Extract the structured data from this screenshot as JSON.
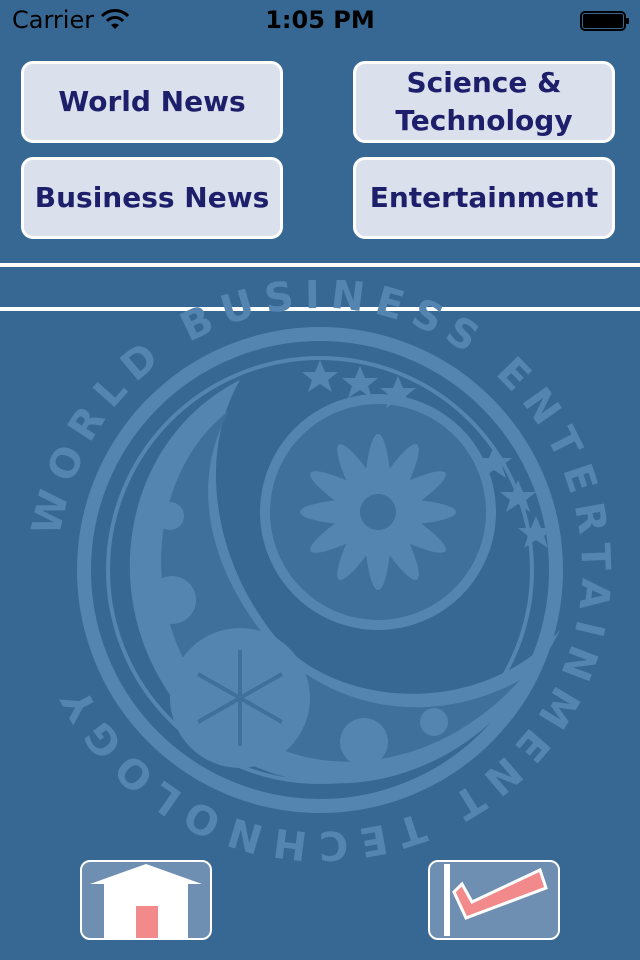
{
  "status_bar": {
    "carrier": "Carrier",
    "time": "1:05 PM"
  },
  "categories": [
    {
      "label_line1": "World News",
      "label_line2": ""
    },
    {
      "label_line1": "Science &",
      "label_line2": "Technology"
    },
    {
      "label_line1": "Business News",
      "label_line2": ""
    },
    {
      "label_line1": "Entertainment",
      "label_line2": ""
    }
  ],
  "emblem": {
    "ring_words": [
      "WORLD",
      "BUSINESS",
      "ENTERTAINMENT",
      "TECHNOLOGY"
    ]
  },
  "toolbar": {
    "home_icon": "home-icon",
    "check_icon": "checkmark-icon"
  },
  "colors": {
    "background": "#376893",
    "button_face": "#dbe1ec",
    "button_text": "#1d1f6b",
    "emblem": "#5484b0",
    "check_accent": "#f08a8c"
  }
}
